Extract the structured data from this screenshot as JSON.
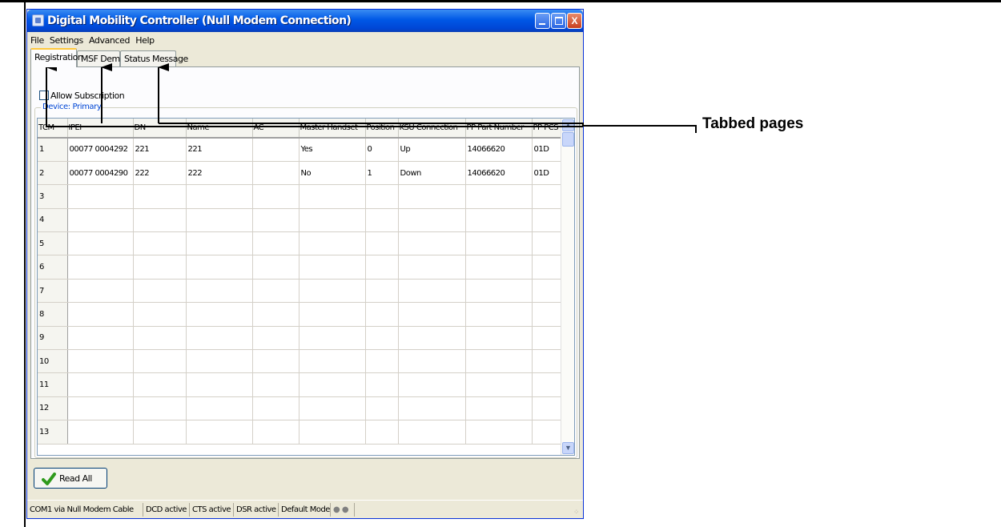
{
  "window": {
    "title": "Digital Mobility Controller (Null Modem Connection)",
    "controls": {
      "minimize": "",
      "maximize": "",
      "close": "X"
    }
  },
  "menu": [
    "File",
    "Settings",
    "Advanced",
    "Help"
  ],
  "tabs": [
    {
      "label": "Registration",
      "active": true
    },
    {
      "label": "MSF Demo",
      "active": false
    },
    {
      "label": "Status Message",
      "active": false
    }
  ],
  "registration": {
    "allow_subscription_label": "Allow Subscription",
    "allow_subscription_checked": false,
    "device_group_label": "Device: Primary",
    "columns": [
      "TCM",
      "IPEI",
      "DN",
      "Name",
      "AC",
      "Master Handset",
      "Position",
      "KSU Connection",
      "PP Part Number",
      "PP PCS"
    ],
    "rows": [
      [
        "1",
        "00077 0004292",
        "221",
        "221",
        "",
        "Yes",
        "0",
        "Up",
        "14066620",
        "01D"
      ],
      [
        "2",
        "00077 0004290",
        "222",
        "222",
        "",
        "No",
        "1",
        "Down",
        "14066620",
        "01D"
      ],
      [
        "3",
        "",
        "",
        "",
        "",
        "",
        "",
        "",
        "",
        ""
      ],
      [
        "4",
        "",
        "",
        "",
        "",
        "",
        "",
        "",
        "",
        ""
      ],
      [
        "5",
        "",
        "",
        "",
        "",
        "",
        "",
        "",
        "",
        ""
      ],
      [
        "6",
        "",
        "",
        "",
        "",
        "",
        "",
        "",
        "",
        ""
      ],
      [
        "7",
        "",
        "",
        "",
        "",
        "",
        "",
        "",
        "",
        ""
      ],
      [
        "8",
        "",
        "",
        "",
        "",
        "",
        "",
        "",
        "",
        ""
      ],
      [
        "9",
        "",
        "",
        "",
        "",
        "",
        "",
        "",
        "",
        ""
      ],
      [
        "10",
        "",
        "",
        "",
        "",
        "",
        "",
        "",
        "",
        ""
      ],
      [
        "11",
        "",
        "",
        "",
        "",
        "",
        "",
        "",
        "",
        ""
      ],
      [
        "12",
        "",
        "",
        "",
        "",
        "",
        "",
        "",
        "",
        ""
      ],
      [
        "13",
        "",
        "",
        "",
        "",
        "",
        "",
        "",
        "",
        ""
      ]
    ],
    "read_all_label": "Read All"
  },
  "statusbar": [
    "COM1 via Null Modem Cable",
    "DCD active",
    "CTS active",
    "DSR active",
    "Default Mode",
    "● ●"
  ],
  "annotation": {
    "label": "Tabbed pages"
  }
}
